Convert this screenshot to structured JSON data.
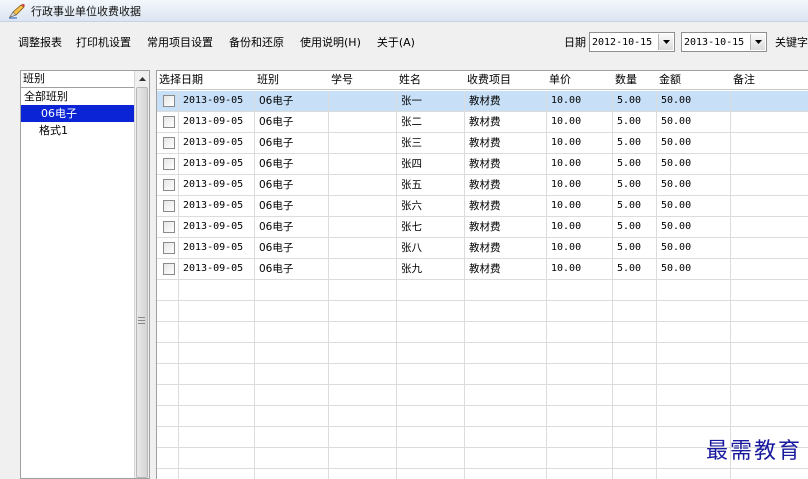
{
  "window": {
    "title": "行政事业单位收费收据"
  },
  "toolbar": {
    "menu": [
      "调整报表",
      "打印机设置",
      "常用项目设置",
      "备份和还原",
      "使用说明(H)",
      "关于(A)"
    ],
    "date_label": "日期",
    "date_from": "2012-10-15",
    "date_to": "2013-10-15",
    "keyword_label": "关键字"
  },
  "sidebar": {
    "header": "班别",
    "items": [
      "全部班别",
      "06电子",
      "格式1"
    ],
    "selected_index": 1
  },
  "grid": {
    "columns": [
      "选择",
      "日期",
      "班别",
      "学号",
      "姓名",
      "收费项目",
      "单价",
      "数量",
      "金额",
      "备注"
    ],
    "selected_row": 0,
    "rows": [
      {
        "date": "2013-09-05",
        "class": "06电子",
        "id": "",
        "name": "张一",
        "item": "教材费",
        "price": "10.00",
        "qty": "5.00",
        "amount": "50.00",
        "note": ""
      },
      {
        "date": "2013-09-05",
        "class": "06电子",
        "id": "",
        "name": "张二",
        "item": "教材费",
        "price": "10.00",
        "qty": "5.00",
        "amount": "50.00",
        "note": ""
      },
      {
        "date": "2013-09-05",
        "class": "06电子",
        "id": "",
        "name": "张三",
        "item": "教材费",
        "price": "10.00",
        "qty": "5.00",
        "amount": "50.00",
        "note": ""
      },
      {
        "date": "2013-09-05",
        "class": "06电子",
        "id": "",
        "name": "张四",
        "item": "教材费",
        "price": "10.00",
        "qty": "5.00",
        "amount": "50.00",
        "note": ""
      },
      {
        "date": "2013-09-05",
        "class": "06电子",
        "id": "",
        "name": "张五",
        "item": "教材费",
        "price": "10.00",
        "qty": "5.00",
        "amount": "50.00",
        "note": ""
      },
      {
        "date": "2013-09-05",
        "class": "06电子",
        "id": "",
        "name": "张六",
        "item": "教材费",
        "price": "10.00",
        "qty": "5.00",
        "amount": "50.00",
        "note": ""
      },
      {
        "date": "2013-09-05",
        "class": "06电子",
        "id": "",
        "name": "张七",
        "item": "教材费",
        "price": "10.00",
        "qty": "5.00",
        "amount": "50.00",
        "note": ""
      },
      {
        "date": "2013-09-05",
        "class": "06电子",
        "id": "",
        "name": "张八",
        "item": "教材费",
        "price": "10.00",
        "qty": "5.00",
        "amount": "50.00",
        "note": ""
      },
      {
        "date": "2013-09-05",
        "class": "06电子",
        "id": "",
        "name": "张九",
        "item": "教材费",
        "price": "10.00",
        "qty": "5.00",
        "amount": "50.00",
        "note": ""
      }
    ]
  },
  "watermark": "最需教育",
  "colors": {
    "selection": "#0a24d6",
    "row_highlight": "#c7e0f7",
    "watermark": "#1a1a9e"
  }
}
